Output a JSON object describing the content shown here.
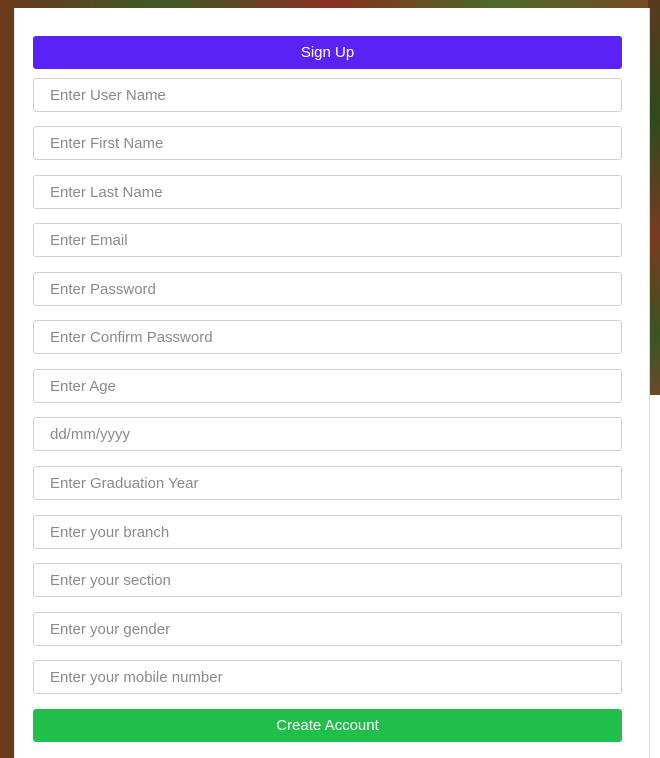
{
  "form": {
    "title": "Sign Up",
    "fields": [
      {
        "placeholder": "Enter User Name"
      },
      {
        "placeholder": "Enter First Name"
      },
      {
        "placeholder": "Enter Last Name"
      },
      {
        "placeholder": "Enter Email"
      },
      {
        "placeholder": "Enter Password"
      },
      {
        "placeholder": "Enter Confirm Password"
      },
      {
        "placeholder": "Enter Age"
      },
      {
        "placeholder": "dd/mm/yyyy"
      },
      {
        "placeholder": "Enter Graduation Year"
      },
      {
        "placeholder": "Enter your branch"
      },
      {
        "placeholder": "Enter your section"
      },
      {
        "placeholder": "Enter your gender"
      },
      {
        "placeholder": "Enter your mobile number"
      }
    ],
    "submit_label": "Create Account"
  },
  "colors": {
    "header": "#5b22f5",
    "submit": "#1fbf4a"
  }
}
